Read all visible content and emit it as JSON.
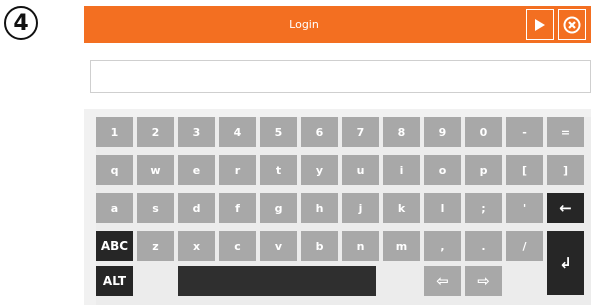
{
  "step_marker": "4",
  "window": {
    "title": "Login",
    "next_icon": "play-icon",
    "close_icon": "close-circle-icon"
  },
  "login_input": {
    "value": "",
    "placeholder": ""
  },
  "colors": {
    "title_bar": "#f36f21",
    "key": "#a8a8a8",
    "key_dark": "#262626",
    "key_text": "#ffffff"
  },
  "keyboard": {
    "row1": [
      "1",
      "2",
      "3",
      "4",
      "5",
      "6",
      "7",
      "8",
      "9",
      "0",
      "-",
      "="
    ],
    "row2": [
      "q",
      "w",
      "e",
      "r",
      "t",
      "y",
      "u",
      "i",
      "o",
      "p",
      "[",
      "]"
    ],
    "row3": [
      "a",
      "s",
      "d",
      "f",
      "g",
      "h",
      "j",
      "k",
      "l",
      ";",
      "'",
      "←"
    ],
    "row4": [
      "ABC",
      "z",
      "x",
      "c",
      "v",
      "b",
      "n",
      "m",
      ",",
      ".",
      "/",
      "↲"
    ],
    "row5": {
      "alt": "ALT",
      "space": "",
      "left_arrow": "⇦",
      "right_arrow": "⇨"
    }
  }
}
